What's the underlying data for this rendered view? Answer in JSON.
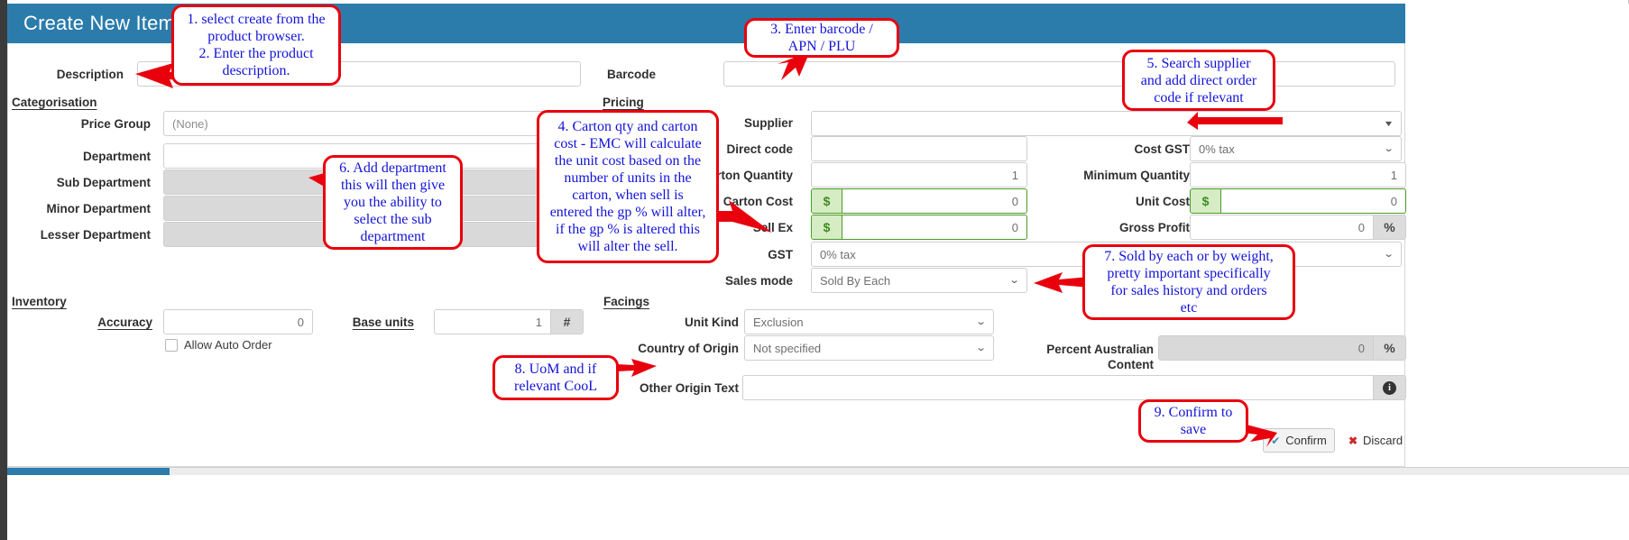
{
  "window": {
    "title": "Create New Item"
  },
  "form": {
    "description_label": "Description",
    "description_value": "",
    "barcode_label": "Barcode",
    "barcode_value": "",
    "categorisation_heading": "Categorisation",
    "pricing_heading": "Pricing",
    "inventory_heading": "Inventory",
    "facings_heading": "Facings",
    "price_group_label": "Price Group",
    "price_group_value": "(None)",
    "department_label": "Department",
    "department_value": "",
    "sub_department_label": "Sub Department",
    "sub_department_value": "",
    "minor_department_label": "Minor Department",
    "minor_department_value": "",
    "lesser_department_label": "Lesser Department",
    "lesser_department_value": "",
    "supplier_label": "Supplier",
    "supplier_value": "",
    "direct_code_label": "Direct code",
    "direct_code_value": "",
    "carton_quantity_label": "rton Quantity",
    "carton_quantity_value": "1",
    "carton_cost_label": "Carton Cost",
    "carton_cost_value": "0",
    "carton_cost_currency": "$",
    "sell_ex_label": "Sell Ex",
    "sell_ex_value": "0",
    "sell_ex_currency": "$",
    "gst_label": "GST",
    "gst_value": "0% tax",
    "sales_mode_label": "Sales mode",
    "sales_mode_value": "Sold By Each",
    "cost_gst_label": "Cost GST",
    "cost_gst_value": "0% tax",
    "minimum_quantity_label": "Minimum Quantity",
    "minimum_quantity_value": "1",
    "unit_cost_label": "Unit Cost",
    "unit_cost_value": "0",
    "unit_cost_currency": "$",
    "gross_profit_label": "Gross Profit",
    "gross_profit_value": "0",
    "gross_profit_suffix": "%",
    "accuracy_label": "Accuracy",
    "accuracy_value": "0",
    "base_units_label": "Base units",
    "base_units_value": "1",
    "base_units_suffix": "#",
    "allow_auto_order_label": "Allow Auto Order",
    "unit_kind_label": "Unit Kind",
    "unit_kind_value": "Exclusion",
    "country_of_origin_label": "Country of Origin",
    "country_of_origin_value": "Not specified",
    "percent_australian_label_line1": "Percent Australian",
    "percent_australian_label_line2": "Content",
    "percent_australian_value": "0",
    "percent_australian_suffix": "%",
    "other_origin_text_label": "Other Origin Text",
    "other_origin_text_value": "",
    "other_origin_info_icon": "info-icon"
  },
  "buttons": {
    "confirm_label": "Confirm",
    "confirm_icon": "check-icon",
    "discard_label": "Discard",
    "discard_icon": "cross-icon"
  },
  "annotations": [
    {
      "id": 1,
      "lines": [
        "1. select create from the",
        "product browser.",
        "2. Enter the product",
        "description."
      ]
    },
    {
      "id": 2,
      "lines": [
        "3. Enter barcode /",
        "APN / PLU"
      ]
    },
    {
      "id": 3,
      "lines": [
        "5. Search supplier",
        "and add direct order",
        "code if relevant"
      ]
    },
    {
      "id": 4,
      "lines": [
        "4. Carton qty and carton",
        "cost - EMC will calculate",
        "the unit cost based on the",
        "number of units in the",
        "carton, when sell is",
        "entered the gp % will alter,",
        "if the gp % is altered this",
        "will alter the sell."
      ]
    },
    {
      "id": 5,
      "lines": [
        "6. Add department",
        "this will then give",
        "you the ability to",
        "select the sub",
        "department"
      ]
    },
    {
      "id": 6,
      "lines": [
        "7. Sold by each or by weight,",
        "pretty important specifically",
        "for sales history and orders",
        "etc"
      ]
    },
    {
      "id": 7,
      "lines": [
        "8. UoM and if",
        "relevant CooL"
      ]
    },
    {
      "id": 8,
      "lines": [
        "9. Confirm to",
        "save"
      ]
    }
  ],
  "colors": {
    "title_bar": "#2b7cab",
    "annotation_border": "#e8000d",
    "annotation_text": "#1313d8",
    "money_border": "#4a9b28",
    "money_fill": "#d6ecc4"
  }
}
